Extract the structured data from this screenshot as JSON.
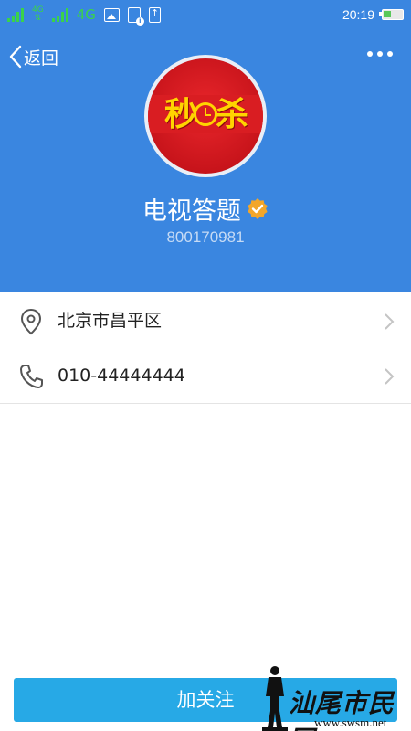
{
  "status_bar": {
    "signal_tag_1": "4G",
    "signal_tag_2": "2",
    "network_small": "4G",
    "network": "4G",
    "time": "20:19"
  },
  "nav": {
    "back_label": "返回",
    "more_icon": "more-dots-icon"
  },
  "profile": {
    "avatar_text_left": "秒",
    "avatar_text_right": "杀",
    "name": "电视答题",
    "verified_icon": "verified-badge-icon",
    "id": "800170981"
  },
  "info": {
    "address": "北京市昌平区",
    "phone": "010-44444444"
  },
  "actions": {
    "follow_label": "加关注"
  },
  "watermark": {
    "title": "汕尾市民网",
    "url": "www.swsm.net"
  },
  "colors": {
    "header_bg": "#3a86e0",
    "follow_button": "#27a9e6",
    "verified_badge": "#f3a62a"
  }
}
